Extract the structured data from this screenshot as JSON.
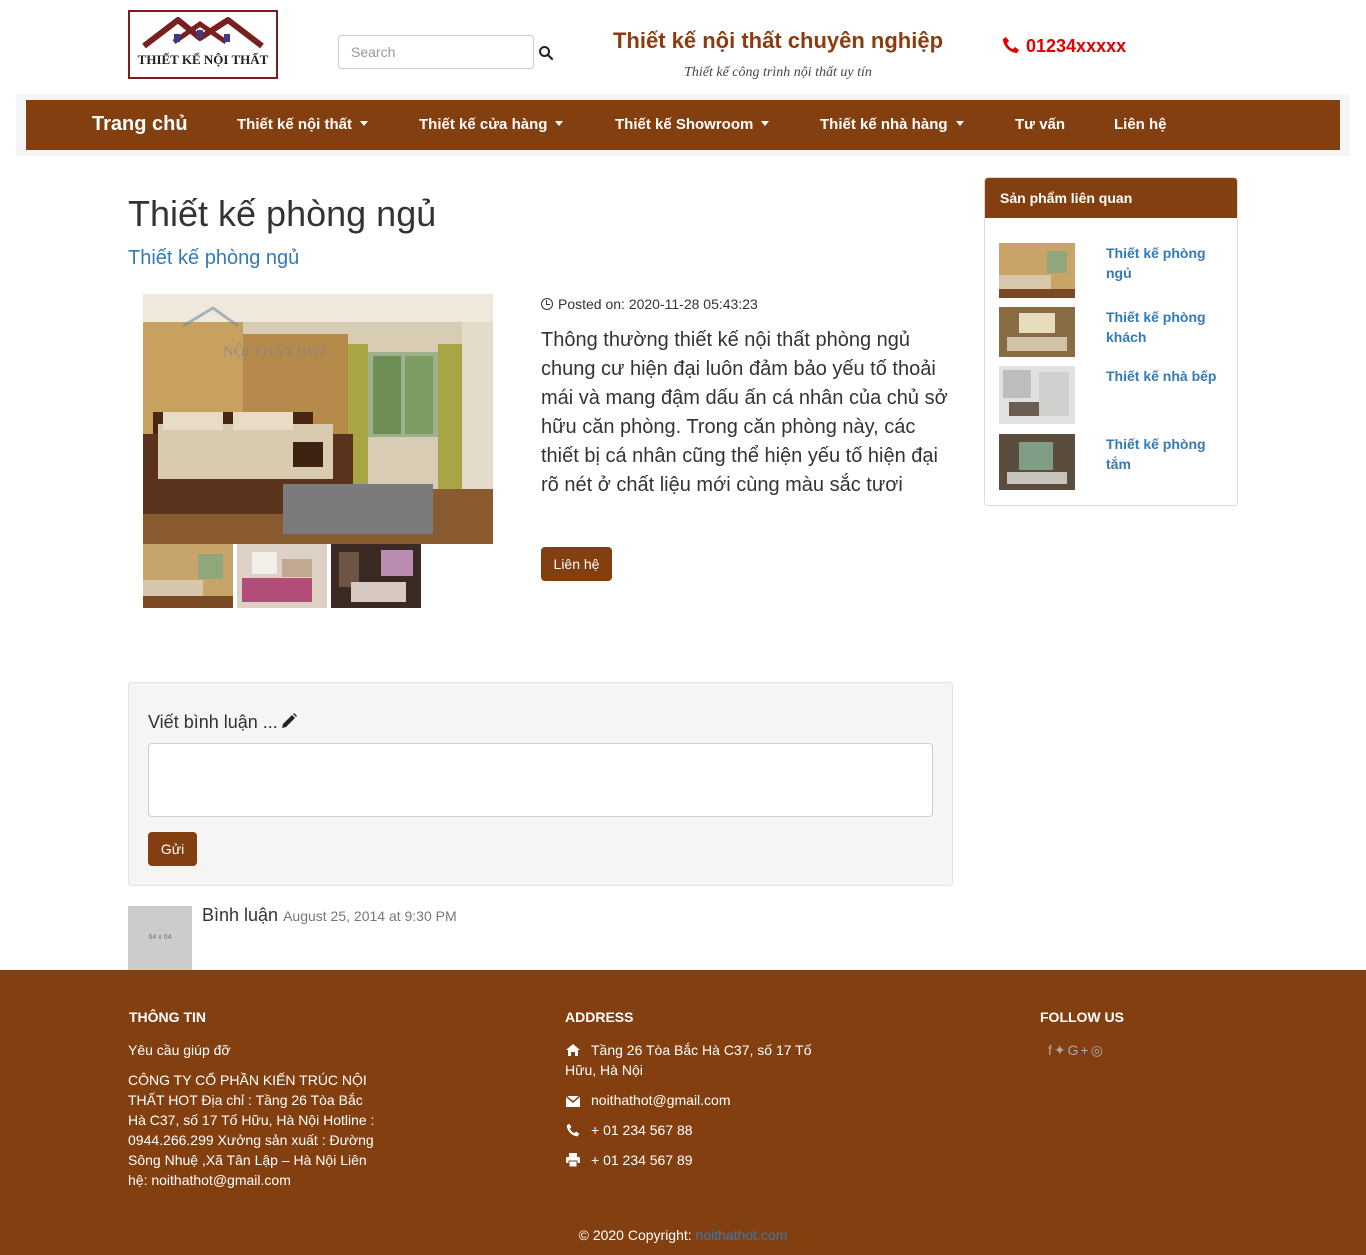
{
  "header": {
    "logo_text": "THIẾT KẾ NỘI THẤT",
    "search_placeholder": "Search",
    "site_title": "Thiết kế nội thất chuyên nghiệp",
    "site_subtitle": "Thiết kế công trình nội thất uy tín",
    "phone": "01234xxxxx"
  },
  "nav": {
    "brand": "Trang chủ",
    "items": [
      {
        "label": "Thiết kế nội thất",
        "dropdown": true
      },
      {
        "label": "Thiết kế cửa hàng",
        "dropdown": true
      },
      {
        "label": "Thiết kế Showroom",
        "dropdown": true
      },
      {
        "label": "Thiết kế nhà hàng",
        "dropdown": true
      },
      {
        "label": "Tư vấn",
        "dropdown": false
      },
      {
        "label": "Liên hệ",
        "dropdown": false
      }
    ]
  },
  "product": {
    "title": "Thiết kế phòng ngủ",
    "subtitle": "Thiết kế phòng ngủ",
    "posted": "Posted on: 2020-11-28 05:43:23",
    "description": "Thông thường thiết kế nội thất phòng ngủ chung cư hiện đại luôn đảm bảo yếu tố thoải mái và mang đậm dấu ấn cá nhân của chủ sở hữu căn phòng. Trong căn phòng này, các thiết bị cá nhân cũng thể hiện yếu tố hiện đại rõ nét ở chất liệu mới cùng màu sắc tươi",
    "contact_label": "Liên hệ",
    "image_watermark": "NỘI THẤT HOT"
  },
  "sidebar": {
    "title": "Sản phẩm liên quan",
    "items": [
      {
        "label": "Thiết kế phòng ngủ"
      },
      {
        "label": "Thiết kế phòng khách"
      },
      {
        "label": "Thiết kế nhà bếp"
      },
      {
        "label": "Thiết kế phòng tắm"
      }
    ]
  },
  "comments": {
    "heading": "Viết bình luận ...",
    "send_label": "Gửi",
    "avatar_label": "64 x 64",
    "author": "Bình luận",
    "date": "August 25, 2014 at 9:30 PM"
  },
  "footer": {
    "info_heading": "THÔNG TIN",
    "help_link": "Yêu cầu giúp đỡ",
    "company_text": "CÔNG TY CỔ PHẦN KIẾN TRÚC NỘI THẤT HOT Địa chỉ : Tầng 26 Tòa Bắc Hà C37, số 17 Tố Hữu, Hà Nội Hotline : 0944.266.299 Xưởng sản xuất : Đường Sông Nhuệ ,Xã Tân Lập – Hà Nội Liên hệ: noithathot@gmail.com",
    "address_heading": "ADDRESS",
    "address": "Tầng 26 Tòa Bắc Hà C37, số 17 Tố Hữu, Hà Nội",
    "email": "noithathot@gmail.com",
    "phone": "+ 01 234 567 88",
    "fax": "+ 01 234 567 89",
    "follow_heading": "FOLLOW US",
    "copyright_prefix": "© 2020 Copyright:",
    "copyright_link": "noithathot.com"
  },
  "colors": {
    "brand_brown": "#843f10",
    "link_blue": "#337ab7",
    "phone_red": "#e00000"
  }
}
